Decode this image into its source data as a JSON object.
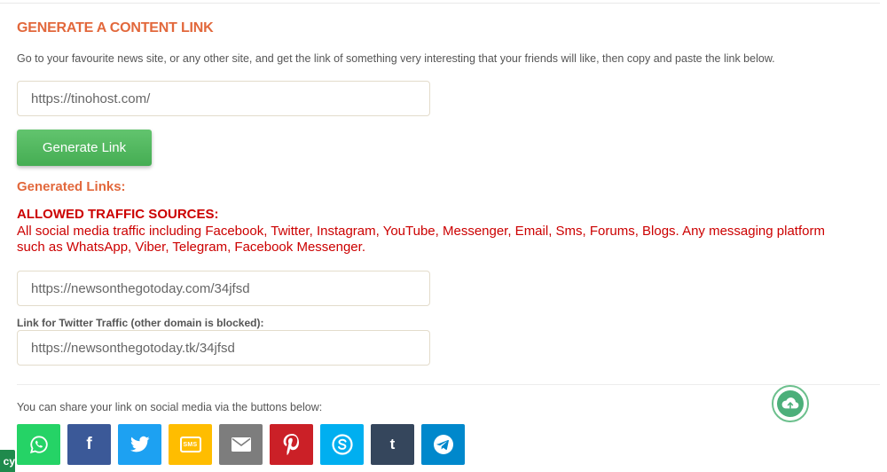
{
  "section": {
    "title": "GENERATE A CONTENT LINK",
    "instructions": "Go to your favourite news site, or any other site, and get the link of something very interesting that your friends will like, then copy and paste the link below."
  },
  "content_input": {
    "value": "https://tinohost.com/"
  },
  "generate_button": {
    "label": "Generate Link"
  },
  "generated": {
    "label": "Generated Links:",
    "allowed_title": "ALLOWED TRAFFIC SOURCES:",
    "allowed_description": "All social media traffic including Facebook, Twitter, Instagram, YouTube, Messenger, Email, Sms, Forums, Blogs. Any messaging platform such as WhatsApp, Viber, Telegram, Facebook Messenger.",
    "link_main": "https://newsonthegotoday.com/34jfsd",
    "twitter_label": "Link for Twitter Traffic (other domain is blocked):",
    "link_twitter": "https://newsonthegotoday.tk/34jfsd"
  },
  "share": {
    "text": "You can share your link on social media via the buttons below:",
    "buttons": [
      {
        "name": "whatsapp",
        "icon": "whatsapp-icon",
        "color": "#25d366"
      },
      {
        "name": "facebook",
        "icon": "facebook-icon",
        "color": "#3b5998",
        "glyph": "f"
      },
      {
        "name": "twitter",
        "icon": "twitter-icon",
        "color": "#1da1f2"
      },
      {
        "name": "sms",
        "icon": "sms-icon",
        "color": "#ffbd00",
        "glyph": "SMS"
      },
      {
        "name": "email",
        "icon": "email-icon",
        "color": "#7d7d7d"
      },
      {
        "name": "pinterest",
        "icon": "pinterest-icon",
        "color": "#cb2027"
      },
      {
        "name": "skype",
        "icon": "skype-icon",
        "color": "#00aff0"
      },
      {
        "name": "tumblr",
        "icon": "tumblr-icon",
        "color": "#35465c",
        "glyph": "t"
      },
      {
        "name": "telegram",
        "icon": "telegram-icon",
        "color": "#0088cc"
      }
    ]
  },
  "privacy_tab": {
    "label": "cy"
  },
  "colors": {
    "accent_orange": "#e2683c",
    "alert_red": "#cc0000",
    "button_green": "#4cb45a"
  }
}
